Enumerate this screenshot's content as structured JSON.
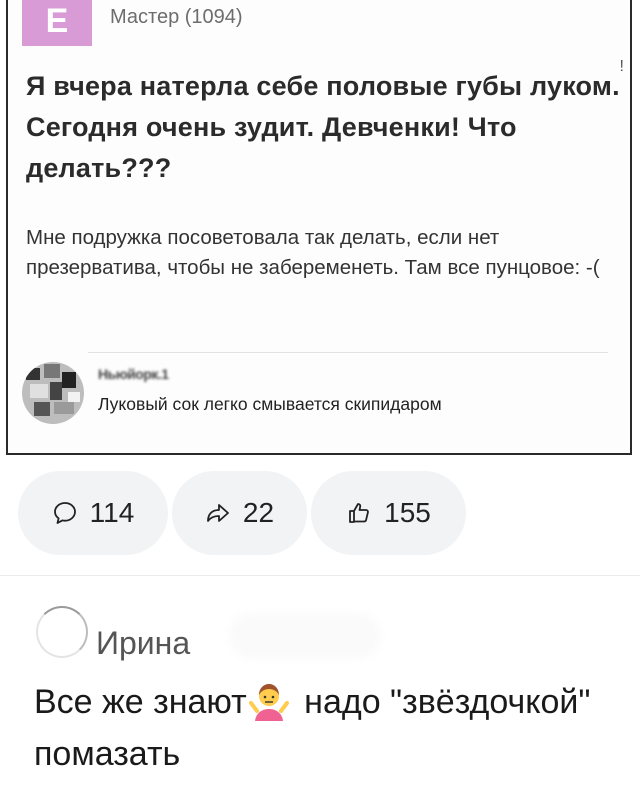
{
  "post": {
    "author": "Мастер (1094)",
    "avatar_letter": "Е",
    "edge_mark": "!",
    "title": "Я вчера натерла себе половые губы луком. Сегодня очень зудит. Девченки! Что делать???",
    "body": "Мне подружка посоветовала так делать, если нет презерватива, чтобы не забеременеть. Там все пунцовое: -(",
    "comment": {
      "name": "Ньюйорк.1",
      "text": "Луковый сок легко смывается скипидаром"
    }
  },
  "actions": {
    "comments": "114",
    "shares": "22",
    "likes": "155"
  },
  "reply": {
    "name": "Ирина",
    "text_before": "Все же знают",
    "emoji": "person-shrugging-emoji",
    "text_after": " надо \"звёздочкой\" помазать"
  }
}
